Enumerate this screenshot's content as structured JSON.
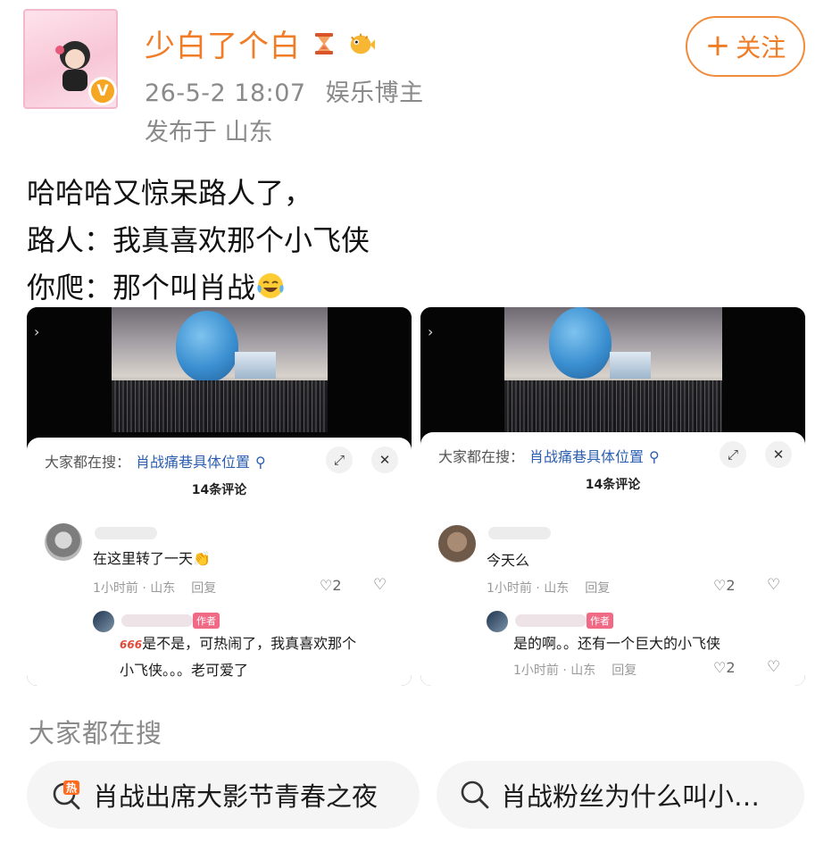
{
  "header": {
    "username": "少白了个白",
    "timestamp": "26-5-2 18:07",
    "user_tag": "娱乐博主",
    "location": "发布于 山东",
    "follow_label": "关注",
    "badges": [
      "hourglass-icon",
      "pufferfish-icon"
    ],
    "verified_badge": "V"
  },
  "post": {
    "lines": [
      "哈哈哈又惊呆路人了，",
      "路人：我真喜欢那个小飞侠",
      "你爬：那个叫肖战"
    ],
    "emoji": "laughing-tears-emoji"
  },
  "images": [
    {
      "search_prefix": "大家都在搜：",
      "search_hot": "肖战痛巷具体位置",
      "count": "14条评论",
      "comment": {
        "text": "在这里转了一天",
        "time": "1小时前 · 山东",
        "reply": "回复",
        "likes": "2"
      },
      "reply": {
        "author_tag": "作者",
        "prefix": "666",
        "line1": "是不是，可热闹了，我真喜欢那个",
        "line2": "小飞侠。。。老可爱了"
      }
    },
    {
      "search_prefix": "大家都在搜：",
      "search_hot": "肖战痛巷具体位置",
      "count": "14条评论",
      "comment": {
        "text": "今天么",
        "time": "1小时前 · 山东",
        "reply": "回复",
        "likes": "2"
      },
      "reply": {
        "author_tag": "作者",
        "line1": "是的啊。。还有一个巨大的小飞侠",
        "time": "1小时前 · 山东",
        "reply": "回复",
        "likes": "2"
      }
    }
  ],
  "search_section": {
    "title": "大家都在搜",
    "chips": [
      {
        "label": "肖战出席大影节青春之夜",
        "icon": "hot-search-icon"
      },
      {
        "label": "肖战粉丝为什么叫小…",
        "icon": "search-icon"
      }
    ]
  },
  "colors": {
    "accent": "#f07c26",
    "link": "#2c5fb1",
    "muted": "#8a8a8a",
    "author_tag": "#f06a86"
  }
}
